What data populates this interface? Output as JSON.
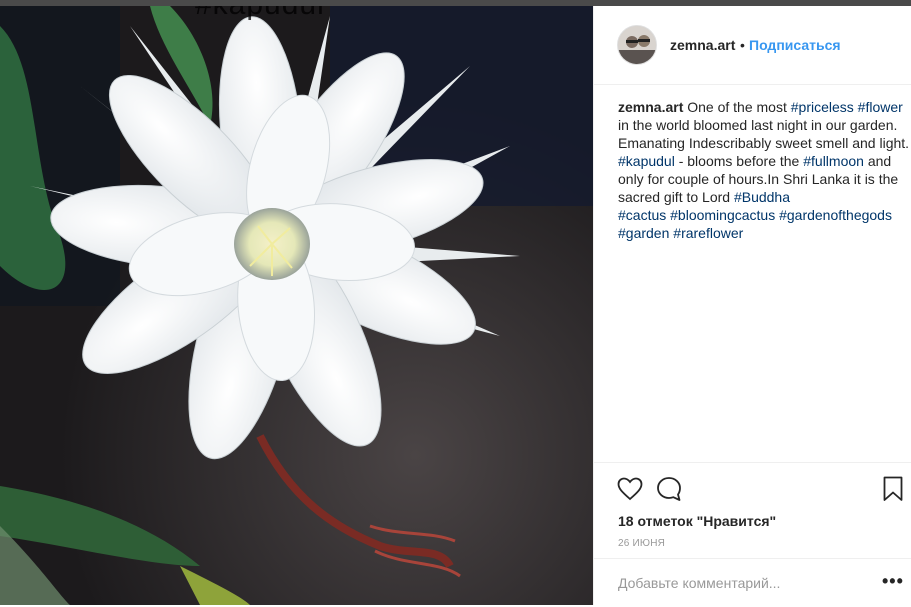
{
  "post": {
    "overlay_text": "#kapudul",
    "username": "zemna.art",
    "separator": "•",
    "follow_label": "Подписаться"
  },
  "caption": {
    "username": "zemna.art",
    "segments": [
      {
        "text": " One of the most "
      },
      {
        "tag": "#priceless"
      },
      {
        "text": " "
      },
      {
        "tag": "#flower"
      },
      {
        "text": " in the world bloomed last night in our garden. Emanating Indescribably sweet smell and light. "
      },
      {
        "tag": "#kapudul"
      },
      {
        "text": " - blooms before the "
      },
      {
        "tag": "#fullmoon"
      },
      {
        "text": " and only for couple of hours.In Shri Lanka it is the sacred gift to Lord "
      },
      {
        "tag": "#Buddha"
      },
      {
        "br": true
      },
      {
        "tag": "#cactus"
      },
      {
        "text": " "
      },
      {
        "tag": "#bloomingcactus"
      },
      {
        "text": " "
      },
      {
        "tag": "#gardenofthegods"
      },
      {
        "text": " "
      },
      {
        "tag": "#garden"
      },
      {
        "text": " "
      },
      {
        "tag": "#rareflower"
      }
    ]
  },
  "actions": {
    "like_icon": "heart-icon",
    "comment_icon": "comment-bubble-icon",
    "save_icon": "bookmark-icon",
    "likes_text": "18 отметок \"Нравится\"",
    "date_text": "26 июня"
  },
  "comment": {
    "placeholder": "Добавьте комментарий...",
    "more_label": "•••"
  },
  "colors": {
    "accent": "#3897f0",
    "hashtag": "#003569",
    "text": "#262626",
    "muted": "#999999",
    "border": "#efefef"
  }
}
